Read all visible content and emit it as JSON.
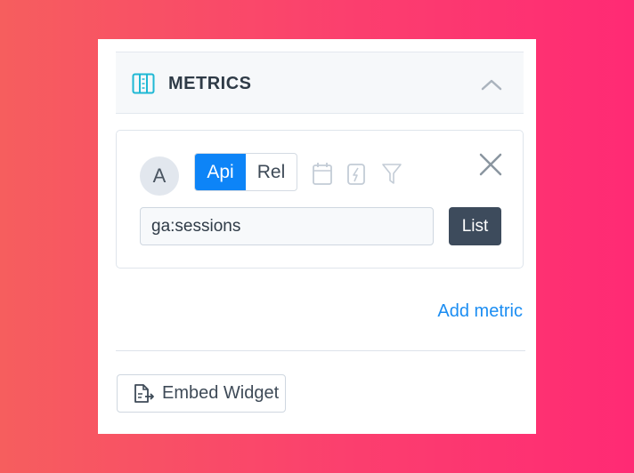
{
  "metrics_section": {
    "title": "METRICS",
    "icon": "columns-icon",
    "collapse_icon": "chevron-up-icon"
  },
  "metric": {
    "avatar_letter": "A",
    "mode_options": [
      "Api",
      "Rel"
    ],
    "active_mode": "Api",
    "tool_icons": [
      "calendar-icon",
      "lightning-icon",
      "filter-icon"
    ],
    "close_icon": "close-icon",
    "input_value": "ga:sessions",
    "list_button_label": "List"
  },
  "add_metric_label": "Add metric",
  "embed_button": {
    "label": "Embed Widget",
    "icon": "embed-document-icon"
  },
  "colors": {
    "accent": "#0d84f7",
    "link": "#1b8df2",
    "dark_button": "#3d4b5c"
  }
}
